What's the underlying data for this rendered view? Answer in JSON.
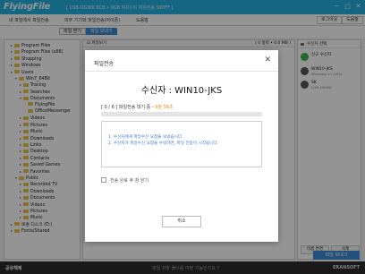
{
  "app": {
    "title": "FlyingFile",
    "title_info": "[ USB-OGWK 8CB • 9GB 여유] 이 자유전송 SWIFF ]",
    "controls": [
      "─",
      "□",
      "✕"
    ]
  },
  "header": {
    "tabs": [
      "내 파일에서 파일전송",
      "외부 기기와 파일전송(아이폰)",
      "도움말"
    ],
    "login_label": "로그아웃",
    "help_label": "도움말"
  },
  "subtabs": [
    "파일 받기",
    "파일 보내기"
  ],
  "file_panel": {
    "header_label": "☑ 파일보기",
    "col_right": "( 0 항목 • 0.0 MB )"
  },
  "tree": [
    {
      "label": "Program Files",
      "depth": 1,
      "toggle": "▸"
    },
    {
      "label": "Program Files (x86)",
      "depth": 1,
      "toggle": "▸"
    },
    {
      "label": "Shopping",
      "depth": 1,
      "toggle": "▸"
    },
    {
      "label": "Windows",
      "depth": 1,
      "toggle": "▸"
    },
    {
      "label": "Users",
      "depth": 1,
      "toggle": "▾"
    },
    {
      "label": "Win7_64Bit",
      "depth": 2,
      "toggle": "▾"
    },
    {
      "label": "Tracing",
      "depth": 3,
      "toggle": "▸"
    },
    {
      "label": "Searches",
      "depth": 3,
      "toggle": "▸"
    },
    {
      "label": "Documents",
      "depth": 3,
      "toggle": "▾"
    },
    {
      "label": "FlyingFile",
      "depth": 4,
      "toggle": ""
    },
    {
      "label": "OfficeMessenger",
      "depth": 4,
      "toggle": ""
    },
    {
      "label": "Videos",
      "depth": 3,
      "toggle": "▸"
    },
    {
      "label": "Pictures",
      "depth": 3,
      "toggle": "▸"
    },
    {
      "label": "Music",
      "depth": 3,
      "toggle": "▸"
    },
    {
      "label": "Downloads",
      "depth": 3,
      "toggle": "▸"
    },
    {
      "label": "Links",
      "depth": 3,
      "toggle": "▸"
    },
    {
      "label": "Desktop",
      "depth": 3,
      "toggle": "▸"
    },
    {
      "label": "Contacts",
      "depth": 3,
      "toggle": "▸"
    },
    {
      "label": "Saved Games",
      "depth": 3,
      "toggle": "▸"
    },
    {
      "label": "Favorites",
      "depth": 3,
      "toggle": "▸"
    },
    {
      "label": "Public",
      "depth": 2,
      "toggle": "▾"
    },
    {
      "label": "Recorded TV",
      "depth": 3,
      "toggle": "▸"
    },
    {
      "label": "Downloads",
      "depth": 3,
      "toggle": "▸"
    },
    {
      "label": "Documents",
      "depth": 3,
      "toggle": "▸"
    },
    {
      "label": "Videos",
      "depth": 3,
      "toggle": "▸"
    },
    {
      "label": "Pictures",
      "depth": 3,
      "toggle": "▸"
    },
    {
      "label": "Music",
      "depth": 3,
      "toggle": "▸"
    },
    {
      "label": "로컬 디스크 (D:)",
      "depth": 1,
      "toggle": "▸"
    },
    {
      "label": "Fonts/Shared",
      "depth": 1,
      "toggle": "▸"
    }
  ],
  "receivers": {
    "header": "수신자 선택",
    "items": [
      {
        "name": "신규 수신자",
        "sub": "",
        "color": "#3cb44a"
      },
      {
        "name": "WIN10-JKS",
        "sub": "Windows 10 (x64)",
        "color": "#555555"
      },
      {
        "name": "SK",
        "sub": "LGM-G600K",
        "color": "#555555"
      }
    ],
    "btn_refresh": "이름 변경",
    "btn_delete": "삭제"
  },
  "send_button": "파일 보내기",
  "status": {
    "left": "공유해제",
    "mid": "파일 저장 폴더를 어떤 기능인가요 ?",
    "right": "ERANSOFT"
  },
  "modal": {
    "title": "파일전송",
    "close": "✕",
    "recipient": "수신자 : WIN10-JKS",
    "progress_prefix": "[ 0 / 6 ]  파일전송 대기 중 - ",
    "progress_remaining": "9분 56초",
    "progress_fraction": 0.0,
    "log": [
      "1. 수신자에게 파일수신 요청을 보냈습니다.",
      "2. 수신자가 파일수신 요청을 수락하면, 파일 전송이 시작됩니다."
    ],
    "checkbox_label": "전송 완료 후 창 닫기",
    "cancel_label": "취소"
  },
  "colors": {
    "accent": "#23b0e0",
    "primary": "#3c8ed4",
    "remaining": "#f08a12"
  }
}
